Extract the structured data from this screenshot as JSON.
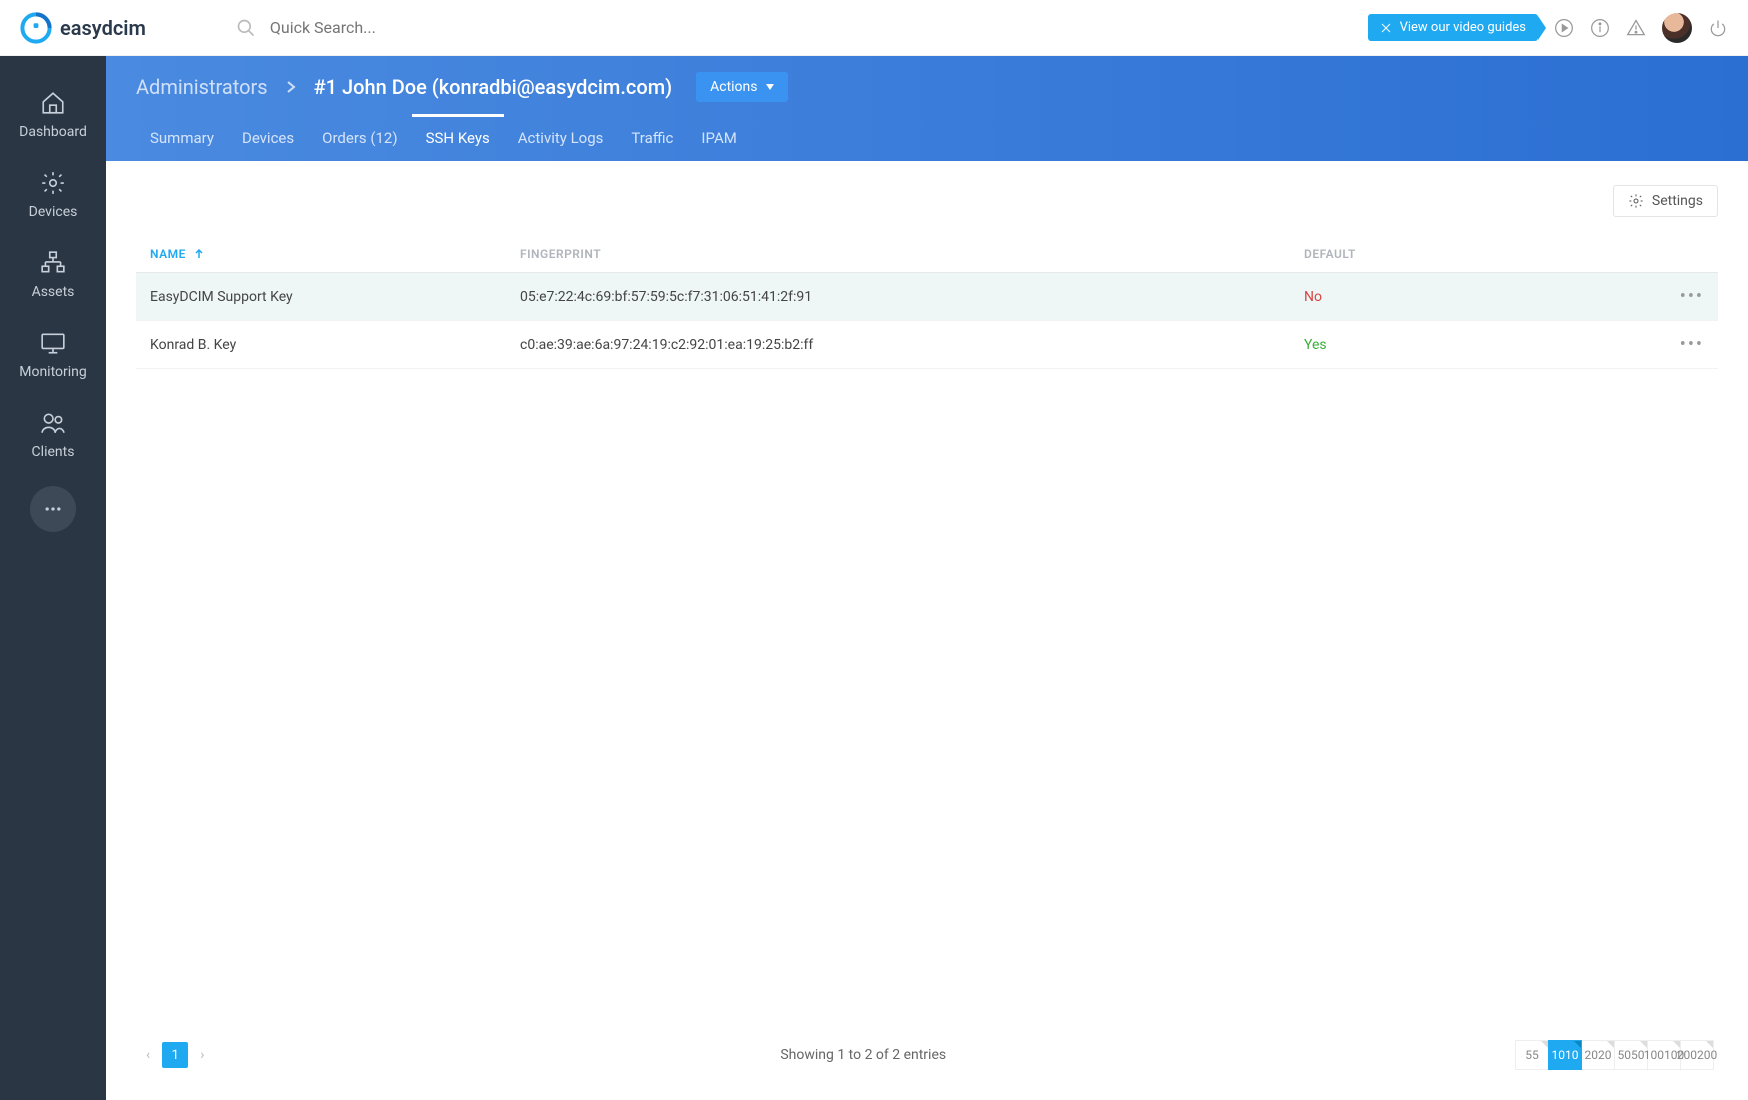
{
  "brand": {
    "name": "easydcim"
  },
  "search": {
    "placeholder": "Quick Search..."
  },
  "topbar": {
    "video_guide_label": "View our video guides"
  },
  "sidebar": {
    "items": [
      {
        "label": "Dashboard"
      },
      {
        "label": "Devices"
      },
      {
        "label": "Assets"
      },
      {
        "label": "Monitoring"
      },
      {
        "label": "Clients"
      }
    ]
  },
  "breadcrumb": {
    "root": "Administrators",
    "current": "#1 John Doe (konradbi@easydcim.com)"
  },
  "actions_label": "Actions",
  "tabs": [
    {
      "label": "Summary"
    },
    {
      "label": "Devices"
    },
    {
      "label": "Orders (12)"
    },
    {
      "label": "SSH Keys",
      "active": true
    },
    {
      "label": "Activity Logs"
    },
    {
      "label": "Traffic"
    },
    {
      "label": "IPAM"
    }
  ],
  "settings_label": "Settings",
  "table": {
    "headers": {
      "name": "NAME",
      "fingerprint": "FINGERPRINT",
      "default": "DEFAULT"
    },
    "rows": [
      {
        "name": "EasyDCIM Support Key",
        "fingerprint": "05:e7:22:4c:69:bf:57:59:5c:f7:31:06:51:41:2f:91",
        "default": "No"
      },
      {
        "name": "Konrad B. Key",
        "fingerprint": "c0:ae:39:ae:6a:97:24:19:c2:92:01:ea:19:25:b2:ff",
        "default": "Yes"
      }
    ]
  },
  "pagination": {
    "current": "1",
    "info": "Showing 1 to 2 of 2 entries"
  },
  "page_sizes": [
    "5",
    "10",
    "20",
    "50",
    "100",
    "200"
  ],
  "active_page_size": "10"
}
